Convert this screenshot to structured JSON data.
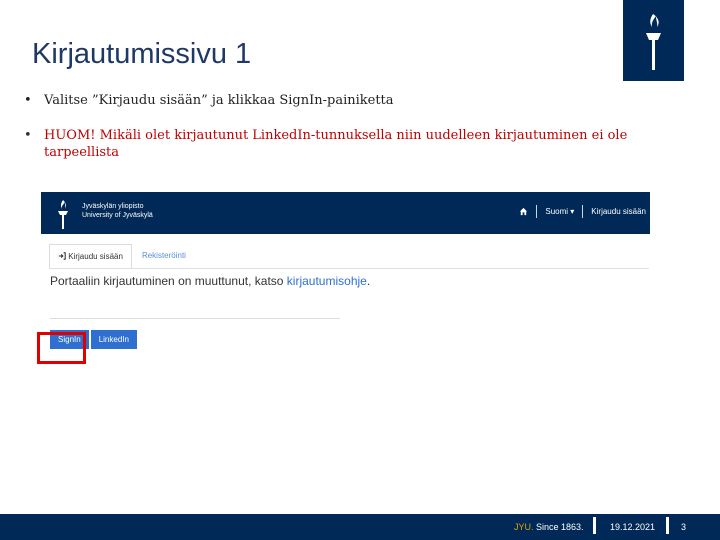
{
  "slide": {
    "title": "Kirjautumissivu 1",
    "bullets": [
      "Valitse ”Kirjaudu sisään” ja klikkaa SignIn-painiketta",
      "HUOM! Mikäli olet kirjautunut LinkedIn-tunnuksella niin uudelleen kirjautuminen ei ole tarpeellista"
    ],
    "bullet_symbol": "•"
  },
  "screenshot": {
    "university_name_fi": "Jyväskylän yliopisto",
    "university_name_en": "University of Jyväskylä",
    "nav": {
      "language": "Suomi",
      "language_caret": "▾",
      "login": "Kirjaudu sisään"
    },
    "tabs": [
      {
        "label": "Kirjaudu sisään",
        "icon": "sign-in-icon"
      },
      {
        "label": "Rekisteröinti"
      }
    ],
    "notice_text": "Portaaliin kirjautuminen on muuttunut, katso ",
    "notice_link": "kirjautumisohje",
    "notice_end": ".",
    "buttons": {
      "signin": "SignIn",
      "linkedin": "LinkedIn"
    }
  },
  "footer": {
    "brand": "JYU.",
    "since": " Since 1863.",
    "date": "19.12.2021",
    "page_number": "3"
  },
  "colors": {
    "navy": "#002957",
    "title": "#1f3864",
    "red_text": "#c00000",
    "highlight": "#e00000",
    "button_blue": "#2f6fd0",
    "jyu_gold": "#e3a200"
  }
}
